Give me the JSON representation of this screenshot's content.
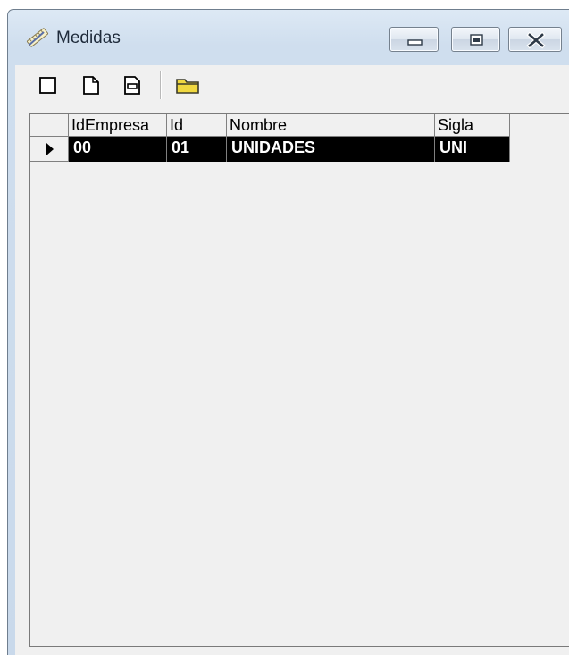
{
  "window": {
    "title": "Medidas",
    "app_icon": "ruler-pencil-icon",
    "controls": {
      "minimize": "minimize-icon",
      "maximize": "maximize-icon",
      "close": "close-icon"
    }
  },
  "toolbar": {
    "buttons": [
      {
        "name": "new-blank-button",
        "icon": "blank-page-icon"
      },
      {
        "name": "new-document-button",
        "icon": "document-icon"
      },
      {
        "name": "edit-record-button",
        "icon": "form-icon"
      },
      {
        "name": "open-folder-button",
        "icon": "folder-icon"
      }
    ]
  },
  "grid": {
    "columns": [
      "IdEmpresa",
      "Id",
      "Nombre",
      "Sigla"
    ],
    "rows": [
      {
        "IdEmpresa": "00",
        "Id": "01",
        "Nombre": "UNIDADES",
        "Sigla": "UNI",
        "selected": true
      }
    ],
    "colors": {
      "selected_bg": "#000000",
      "selected_fg": "#ffffff",
      "folder": "#f0d840"
    }
  }
}
